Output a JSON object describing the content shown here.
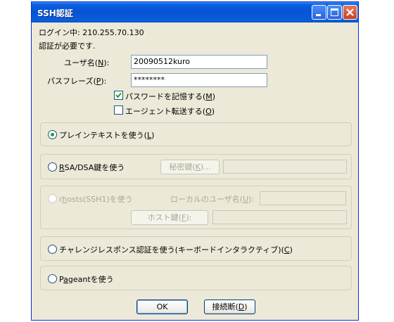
{
  "window": {
    "title": "SSH認証"
  },
  "info": {
    "login_label": "ログイン中: 210.255.70.130",
    "auth_required": "認証が必要です."
  },
  "fields": {
    "username": {
      "label_pre": "ユーザ名(",
      "hotkey": "N",
      "label_post": "):",
      "value": "20090512kuro"
    },
    "passphrase": {
      "label_pre": "パスフレーズ(",
      "hotkey": "P",
      "label_post": "):",
      "value": "********"
    }
  },
  "checkboxes": {
    "remember_password": {
      "label_pre": "パスワードを記憶する(",
      "hotkey": "M",
      "label_post": ")",
      "checked": true
    },
    "agent_forwarding": {
      "label_pre": "エージェント転送する(",
      "hotkey": "O",
      "label_post": ")",
      "checked": false
    }
  },
  "methods": {
    "plaintext": {
      "label_pre": "プレインテキストを使う(",
      "hotkey": "L",
      "label_post": ")",
      "selected": true
    },
    "rsa_dsa": {
      "hotkey": "R",
      "label_post": "SA/DSA鍵を使う",
      "selected": false,
      "key_button_pre": "秘密鍵(",
      "key_button_hotkey": "K",
      "key_button_post": ")..."
    },
    "rhosts": {
      "label_pre": "r",
      "hotkey": "h",
      "label_post": "osts(SSH1)を使う",
      "selected": false,
      "local_user_pre": "ローカルのユーザ名(",
      "local_user_hotkey": "U",
      "local_user_post": "):",
      "host_key_pre": "ホスト鍵(",
      "host_key_hotkey": "F",
      "host_key_post": "):"
    },
    "challenge": {
      "label_pre": "チャレンジレスポンス認証を使う(キーボードインタラクティブ)(",
      "hotkey": "C",
      "label_post": ")",
      "selected": false
    },
    "pageant": {
      "label_pre": "P",
      "hotkey": "a",
      "label_post": "geantを使う",
      "selected": false
    }
  },
  "buttons": {
    "ok": "OK",
    "disconnect_pre": "接続断(",
    "disconnect_hotkey": "D",
    "disconnect_post": ")"
  }
}
